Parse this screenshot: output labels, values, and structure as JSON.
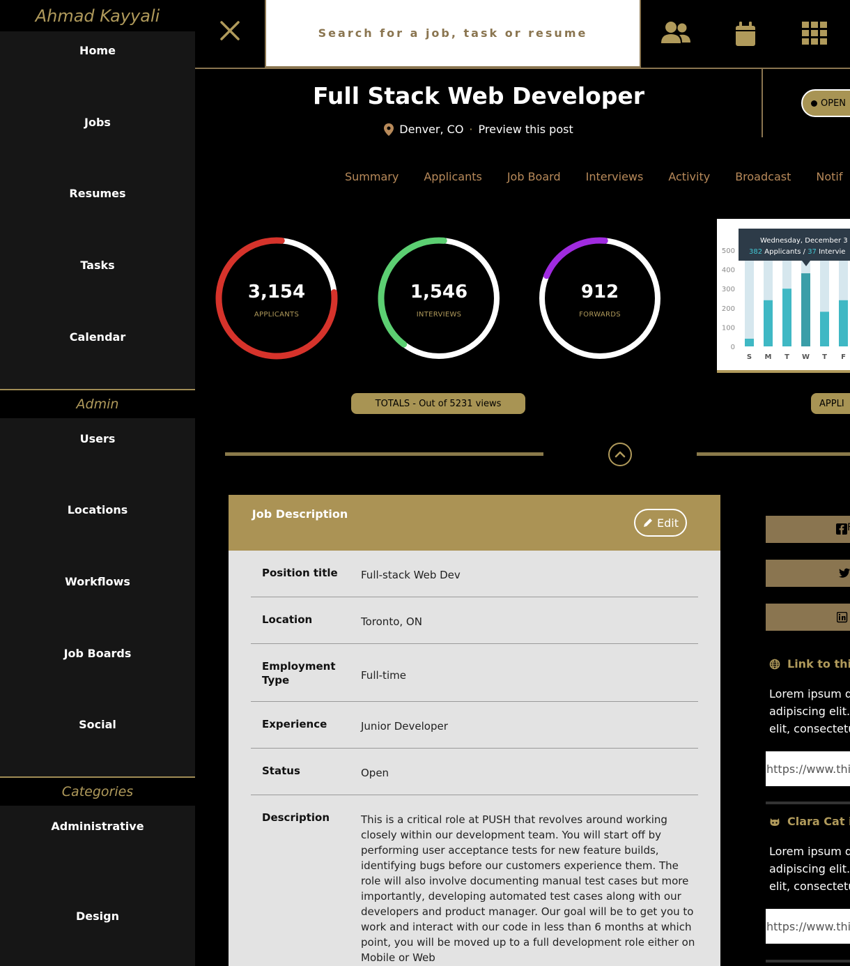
{
  "sidebar": {
    "brand": "Ahmad Kayyali",
    "main": [
      "Home",
      "Jobs",
      "Resumes",
      "Tasks",
      "Calendar"
    ],
    "admin_heading": "Admin",
    "admin": [
      "Users",
      "Locations",
      "Workflows",
      "Job Boards",
      "Social"
    ],
    "categories_heading": "Categories",
    "categories": [
      "Administrative",
      "Design"
    ]
  },
  "topbar": {
    "search_placeholder": "Search for a job, task or resume",
    "icons": [
      "users-icon",
      "calendar-icon",
      "grid-icon"
    ]
  },
  "job": {
    "title": "Full Stack Web Developer",
    "location": "Denver, CO",
    "preview_link": "Preview this post",
    "status_badge": "OPEN"
  },
  "tabs": [
    "Summary",
    "Applicants",
    "Job Board",
    "Interviews",
    "Activity",
    "Broadcast",
    "Notif"
  ],
  "stats": [
    {
      "value": "3,154",
      "label": "APPLICANTS",
      "fraction": 0.78,
      "color": "#d6332b"
    },
    {
      "value": "1,546",
      "label": "INTERVIEWS",
      "fraction": 0.41,
      "color": "#5ccf72"
    },
    {
      "value": "912",
      "label": "FORWARDS",
      "fraction": 0.2,
      "color": "#a02be0"
    }
  ],
  "chart_data": {
    "type": "bar",
    "categories": [
      "S",
      "M",
      "T",
      "W",
      "T",
      "F"
    ],
    "values": [
      40,
      240,
      300,
      380,
      180,
      240
    ],
    "ylim": [
      0,
      500
    ],
    "yticks": [
      0,
      100,
      200,
      300,
      400,
      500
    ],
    "tooltip": {
      "date": "Wednesday, December 3",
      "applicants_value": "382",
      "applicants_label": "Applicants",
      "separator": "/",
      "interviews_value": "37",
      "interviews_label": "Intervie"
    },
    "colors": {
      "bar": "#3fb8c4",
      "track": "#d6e7ee",
      "tooltip_bg": "#2d3b48"
    }
  },
  "totals_button": "TOTALS - Out of 5231 views",
  "appl_button": "APPLI",
  "job_description": {
    "heading": "Job Description",
    "edit_label": "Edit",
    "rows": [
      {
        "key": "Position title",
        "value": "Full-stack Web Dev"
      },
      {
        "key": "Location",
        "value": "Toronto, ON"
      },
      {
        "key": "Employment Type",
        "value": "Full-time"
      },
      {
        "key": "Experience",
        "value": "Junior Developer"
      },
      {
        "key": "Status",
        "value": "Open"
      },
      {
        "key": "Description",
        "value": "This is a critical role at PUSH that revolves around working closely within our development team. You will start off by performing user acceptance tests for new feature builds, identifying bugs before our customers experience them. The role will also involve documenting manual test cases but more importantly, developing automated test cases along with our developers and product manager. Our goal will be to get you to work and interact with our code in less than 6 months at which point, you will be moved up to a full development role either on Mobile or Web"
      }
    ]
  },
  "side_panel": {
    "share_f_text": "F",
    "link_heading": "Link to this",
    "link_text": [
      "Lorem ipsum d",
      "adipiscing elit.",
      "elit, consectetu"
    ],
    "link_url": "https://www.thi",
    "cat_heading": "Clara Cat is",
    "cat_text": [
      "Lorem ipsum d",
      "adipiscing elit.",
      "elit, consectetu"
    ],
    "cat_url": "https://www.thi"
  }
}
